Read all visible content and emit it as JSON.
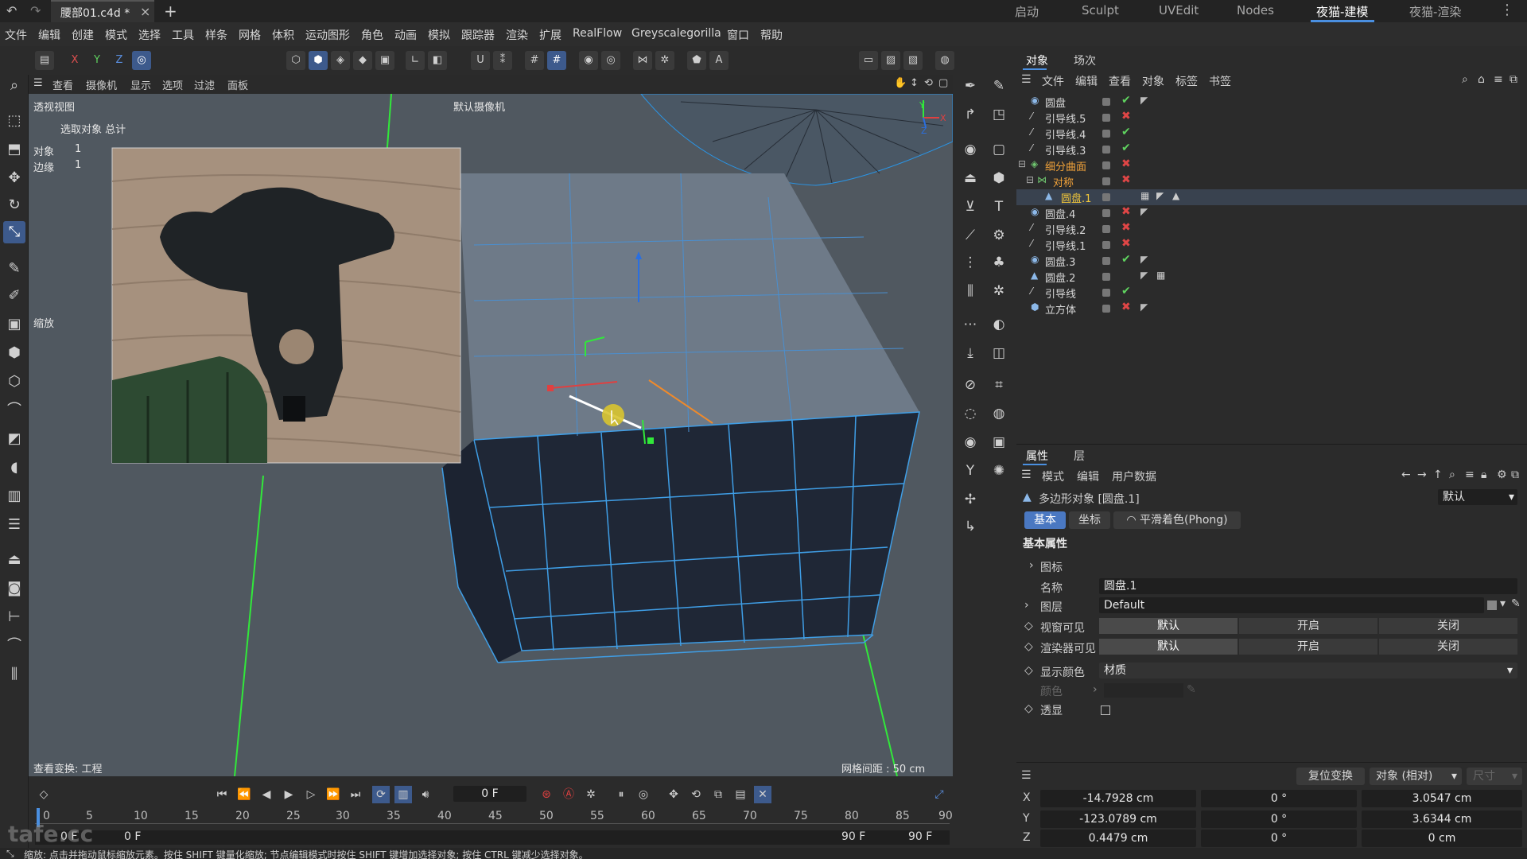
{
  "titlebar": {
    "doc_tab": "腰部01.c4d *",
    "layouts": [
      "启动",
      "Sculpt",
      "UVEdit",
      "Nodes",
      "夜猫-建模",
      "夜猫-渲染"
    ],
    "active_layout": "夜猫-建模"
  },
  "menubar": [
    "文件",
    "编辑",
    "创建",
    "模式",
    "选择",
    "工具",
    "样条",
    "网格",
    "体积",
    "运动图形",
    "角色",
    "动画",
    "模拟",
    "跟踪器",
    "渲染",
    "扩展",
    "RealFlow",
    "Greyscalegorilla",
    "窗口",
    "帮助"
  ],
  "toolbar": {
    "axes": [
      "X",
      "Y",
      "Z"
    ]
  },
  "viewport": {
    "menu": [
      "查看",
      "摄像机",
      "显示",
      "选项",
      "过滤",
      "面板"
    ],
    "name": "透视视图",
    "camera": "默认摄像机",
    "stats_header": "选取对象 总计",
    "stats": [
      {
        "label": "对象",
        "value": "1"
      },
      {
        "label": "边缘",
        "value": "1"
      }
    ],
    "scale_label": "缩放",
    "bottom_left": "查看变换: 工程",
    "grid_spacing": "网格间距 : 50 cm",
    "axis_labels": [
      "Y",
      "X",
      "Z"
    ]
  },
  "timeline": {
    "frame_field": "0 F",
    "ruler": [
      "0",
      "5",
      "10",
      "15",
      "20",
      "25",
      "30",
      "35",
      "40",
      "45",
      "50",
      "55",
      "60",
      "65",
      "70",
      "75",
      "80",
      "85",
      "90"
    ],
    "start_a": "0 F",
    "start_b": "0 F",
    "end_a": "90 F",
    "end_b": "90 F",
    "watermark": "tafe.cc"
  },
  "statusbar": "缩放: 点击并拖动鼠标缩放元素。按住 SHIFT 键量化缩放; 节点编辑模式时按住 SHIFT 键增加选择对象; 按住 CTRL 键减少选择对象。",
  "object_panel": {
    "tabs": [
      "对象",
      "场次"
    ],
    "menu": [
      "文件",
      "编辑",
      "查看",
      "对象",
      "标签",
      "书签"
    ],
    "rows": [
      {
        "name": "圆盘",
        "icon": "cylinder-icon",
        "state": "on",
        "indent": 0,
        "tag": true
      },
      {
        "name": "引导线.5",
        "icon": "spline-icon",
        "state": "off",
        "indent": 0,
        "tag": false
      },
      {
        "name": "引导线.4",
        "icon": "spline-icon",
        "state": "on",
        "indent": 0,
        "tag": false
      },
      {
        "name": "引导线.3",
        "icon": "spline-icon",
        "state": "on",
        "indent": 0,
        "tag": false
      },
      {
        "name": "细分曲面",
        "icon": "subdivision-icon",
        "state": "off",
        "indent": 0,
        "tag": false,
        "color": "orange"
      },
      {
        "name": "对称",
        "icon": "symmetry-icon",
        "state": "off",
        "indent": 1,
        "tag": false,
        "color": "orange"
      },
      {
        "name": "圆盘.1",
        "icon": "polygon-icon",
        "state": "none",
        "indent": 2,
        "tag": true,
        "color": "yellow",
        "selected": true
      },
      {
        "name": "圆盘.4",
        "icon": "cylinder-icon",
        "state": "off",
        "indent": 0,
        "tag": true
      },
      {
        "name": "引导线.2",
        "icon": "spline-icon",
        "state": "off",
        "indent": 0,
        "tag": false
      },
      {
        "name": "引导线.1",
        "icon": "spline-icon",
        "state": "off",
        "indent": 0,
        "tag": false
      },
      {
        "name": "圆盘.3",
        "icon": "cylinder-icon",
        "state": "on",
        "indent": 0,
        "tag": true
      },
      {
        "name": "圆盘.2",
        "icon": "polygon-icon",
        "state": "none",
        "indent": 0,
        "tag": true
      },
      {
        "name": "引导线",
        "icon": "spline-icon",
        "state": "on",
        "indent": 0,
        "tag": false
      },
      {
        "name": "立方体",
        "icon": "cube-icon",
        "state": "off",
        "indent": 0,
        "tag": true
      }
    ]
  },
  "attr_panel": {
    "tabs": [
      "属性",
      "层"
    ],
    "menu": [
      "模式",
      "编辑",
      "用户数据"
    ],
    "object_title": "多边形对象 [圆盘.1]",
    "preset": "默认",
    "chips": [
      "基本",
      "坐标",
      "平滑着色(Phong)"
    ],
    "section": "基本属性",
    "group": "图标",
    "name_label": "名称",
    "name_value": "圆盘.1",
    "layer_label": "图层",
    "layer_value": "Default",
    "editor_vis_label": "视窗可见",
    "render_vis_label": "渲染器可见",
    "vis_options": [
      "默认",
      "开启",
      "关闭"
    ],
    "display_color_label": "显示颜色",
    "display_color_value": "材质",
    "color_label": "颜色",
    "xray_label": "透显"
  },
  "coord_panel": {
    "reset_button": "复位变换",
    "mode": "对象 (相对)",
    "size_label": "尺寸",
    "rows": [
      {
        "axis": "X",
        "pos": "-14.7928 cm",
        "rot": "0 °",
        "size": "3.0547 cm"
      },
      {
        "axis": "Y",
        "pos": "-123.0789 cm",
        "rot": "0 °",
        "size": "3.6344 cm"
      },
      {
        "axis": "Z",
        "pos": "0.4479 cm",
        "rot": "0 °",
        "size": "0 cm"
      }
    ]
  },
  "colors": {
    "accent": "#4a8fe0",
    "viewport_bg": "#4f5760",
    "mesh_top": "#6e7a88",
    "mesh_side": "#1f2736",
    "wire": "#3f9ee6"
  }
}
